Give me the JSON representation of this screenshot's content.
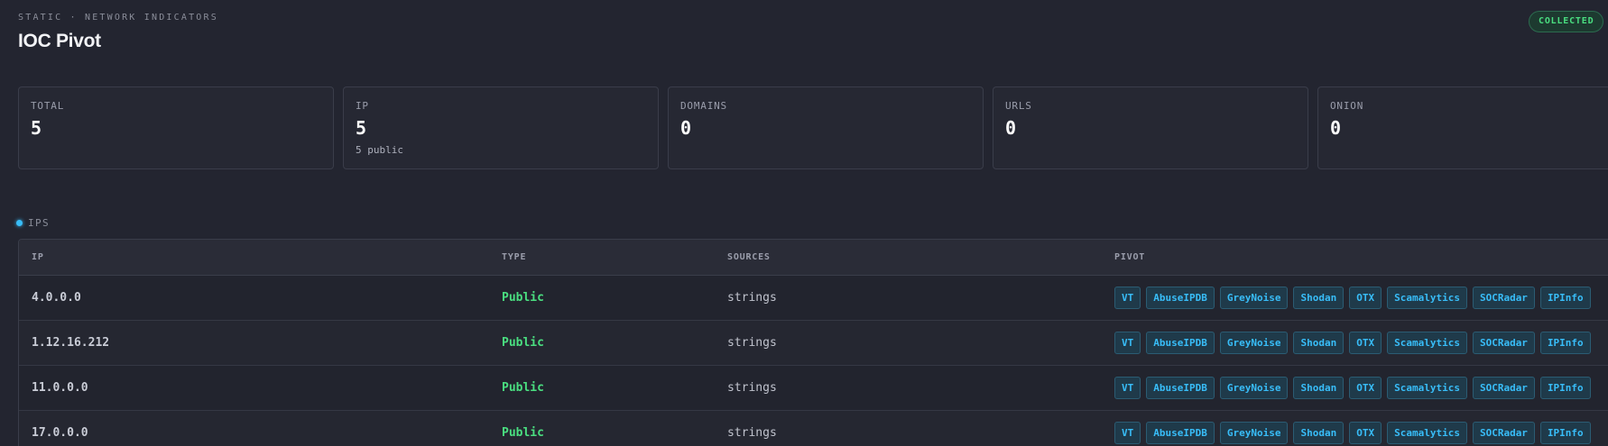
{
  "header": {
    "eyebrow": "STATIC · NETWORK INDICATORS",
    "title": "IOC Pivot",
    "status": "COLLECTED"
  },
  "stats": [
    {
      "label": "TOTAL",
      "value": "5",
      "sub": ""
    },
    {
      "label": "IP",
      "value": "5",
      "sub": "5 public"
    },
    {
      "label": "DOMAINS",
      "value": "0",
      "sub": ""
    },
    {
      "label": "URLS",
      "value": "0",
      "sub": ""
    },
    {
      "label": "ONION",
      "value": "0",
      "sub": ""
    }
  ],
  "section": {
    "label": "IPS"
  },
  "table": {
    "columns": [
      "IP",
      "TYPE",
      "SOURCES",
      "PIVOT"
    ],
    "pivots": [
      "VT",
      "AbuseIPDB",
      "GreyNoise",
      "Shodan",
      "OTX",
      "Scamalytics",
      "SOCRadar",
      "IPInfo"
    ],
    "rows": [
      {
        "ip": "4.0.0.0",
        "type": "Public",
        "sources": "strings"
      },
      {
        "ip": "1.12.16.212",
        "type": "Public",
        "sources": "strings"
      },
      {
        "ip": "11.0.0.0",
        "type": "Public",
        "sources": "strings"
      },
      {
        "ip": "17.0.0.0",
        "type": "Public",
        "sources": "strings"
      }
    ]
  },
  "colors": {
    "accent": "#38bdf8",
    "success": "#4ade80",
    "background": "#232530"
  }
}
